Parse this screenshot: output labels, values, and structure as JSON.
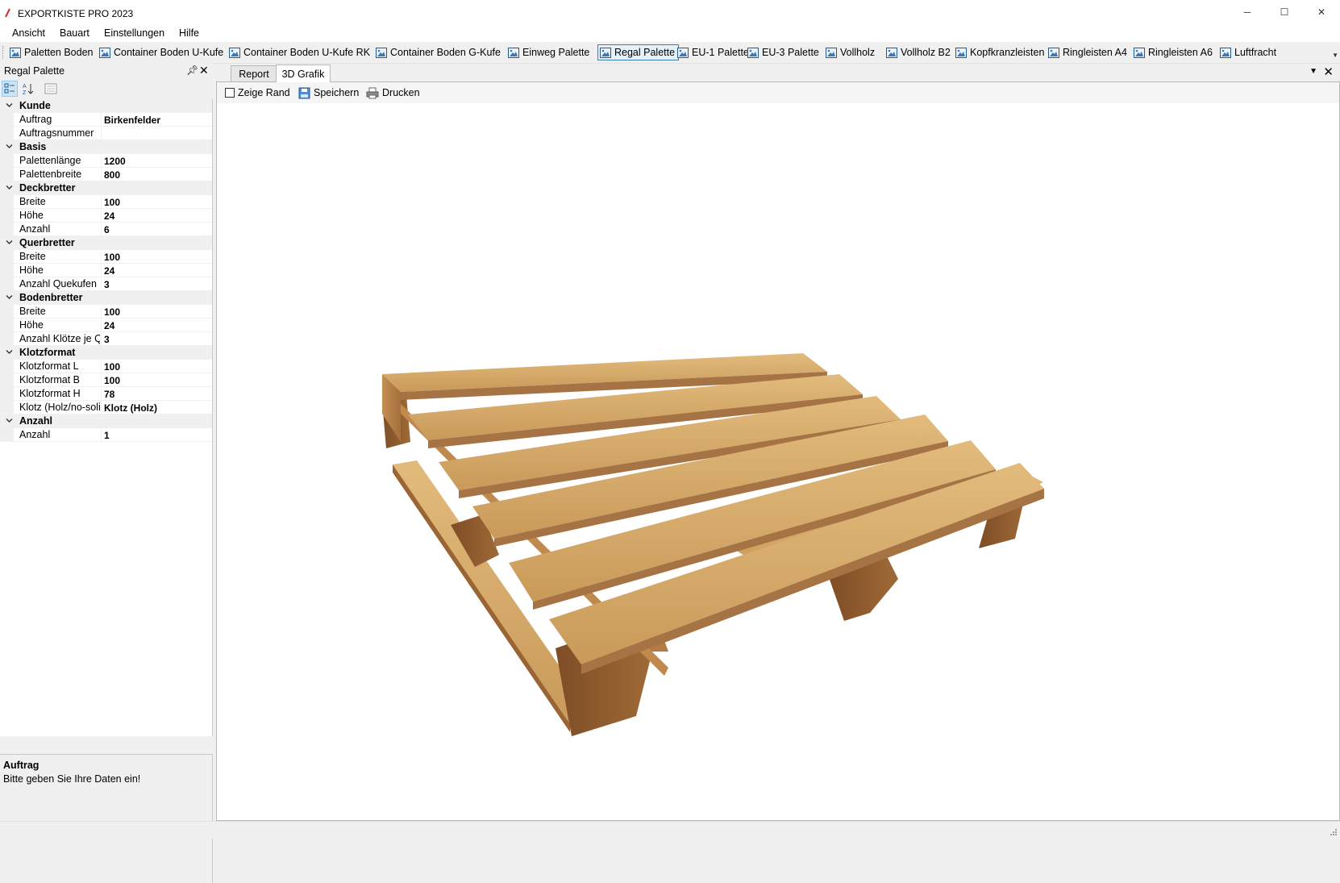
{
  "app": {
    "title": "EXPORTKISTE PRO 2023"
  },
  "window_controls": {
    "minimize": "─",
    "maximize": "☐",
    "close": "✕"
  },
  "menu": [
    "Ansicht",
    "Bauart",
    "Einstellungen",
    "Hilfe"
  ],
  "toolbar": {
    "items": [
      "Paletten Boden",
      "Container Boden U-Kufe",
      "Container Boden U-Kufe RK",
      "Container Boden G-Kufe",
      "Einweg Palette",
      "Regal Palette",
      "EU-1 Palette",
      "EU-3 Palette",
      "Vollholz",
      "Vollholz B2",
      "Kopfkranzleisten",
      "Ringleisten A4",
      "Ringleisten A6",
      "Luftfracht"
    ],
    "active": "Regal Palette"
  },
  "left_panel": {
    "title": "Regal Palette",
    "categories": [
      {
        "name": "Kunde",
        "rows": [
          {
            "name": "Auftrag",
            "value": "Birkenfelder"
          },
          {
            "name": "Auftragsnummer",
            "value": ""
          }
        ]
      },
      {
        "name": "Basis",
        "rows": [
          {
            "name": "Palettenlänge",
            "value": "1200"
          },
          {
            "name": "Palettenbreite",
            "value": "800"
          }
        ]
      },
      {
        "name": "Deckbretter",
        "rows": [
          {
            "name": "Breite",
            "value": "100"
          },
          {
            "name": "Höhe",
            "value": "24"
          },
          {
            "name": "Anzahl",
            "value": "6"
          }
        ]
      },
      {
        "name": "Querbretter",
        "rows": [
          {
            "name": "Breite",
            "value": "100"
          },
          {
            "name": "Höhe",
            "value": "24"
          },
          {
            "name": "Anzahl Quekufen",
            "value": "3"
          }
        ]
      },
      {
        "name": "Bodenbretter",
        "rows": [
          {
            "name": "Breite",
            "value": "100"
          },
          {
            "name": "Höhe",
            "value": "24"
          },
          {
            "name": "Anzahl Klötze je Q",
            "value": "3"
          }
        ]
      },
      {
        "name": "Klotzformat",
        "rows": [
          {
            "name": "Klotzformat L",
            "value": "100"
          },
          {
            "name": "Klotzformat B",
            "value": "100"
          },
          {
            "name": "Klotzformat H",
            "value": "78"
          },
          {
            "name": "Klotz (Holz/no-soli",
            "value": "Klotz (Holz)"
          }
        ]
      },
      {
        "name": "Anzahl",
        "rows": [
          {
            "name": "Anzahl",
            "value": "1"
          }
        ]
      }
    ],
    "description": {
      "title": "Auftrag",
      "text": "Bitte geben Sie Ihre Daten ein!"
    }
  },
  "doc_tabs": [
    "Report",
    "3D Grafik"
  ],
  "active_doc_tab": "3D Grafik",
  "viewer_toolbar": {
    "show_border_label": "Zeige Rand",
    "show_border_checked": false,
    "save_label": "Speichern",
    "print_label": "Drucken"
  },
  "colors": {
    "wood_top": "#d7ab69",
    "wood_side": "#b9834a",
    "wood_dark": "#8a5a2e",
    "accent_border": "#3c7fb1"
  }
}
